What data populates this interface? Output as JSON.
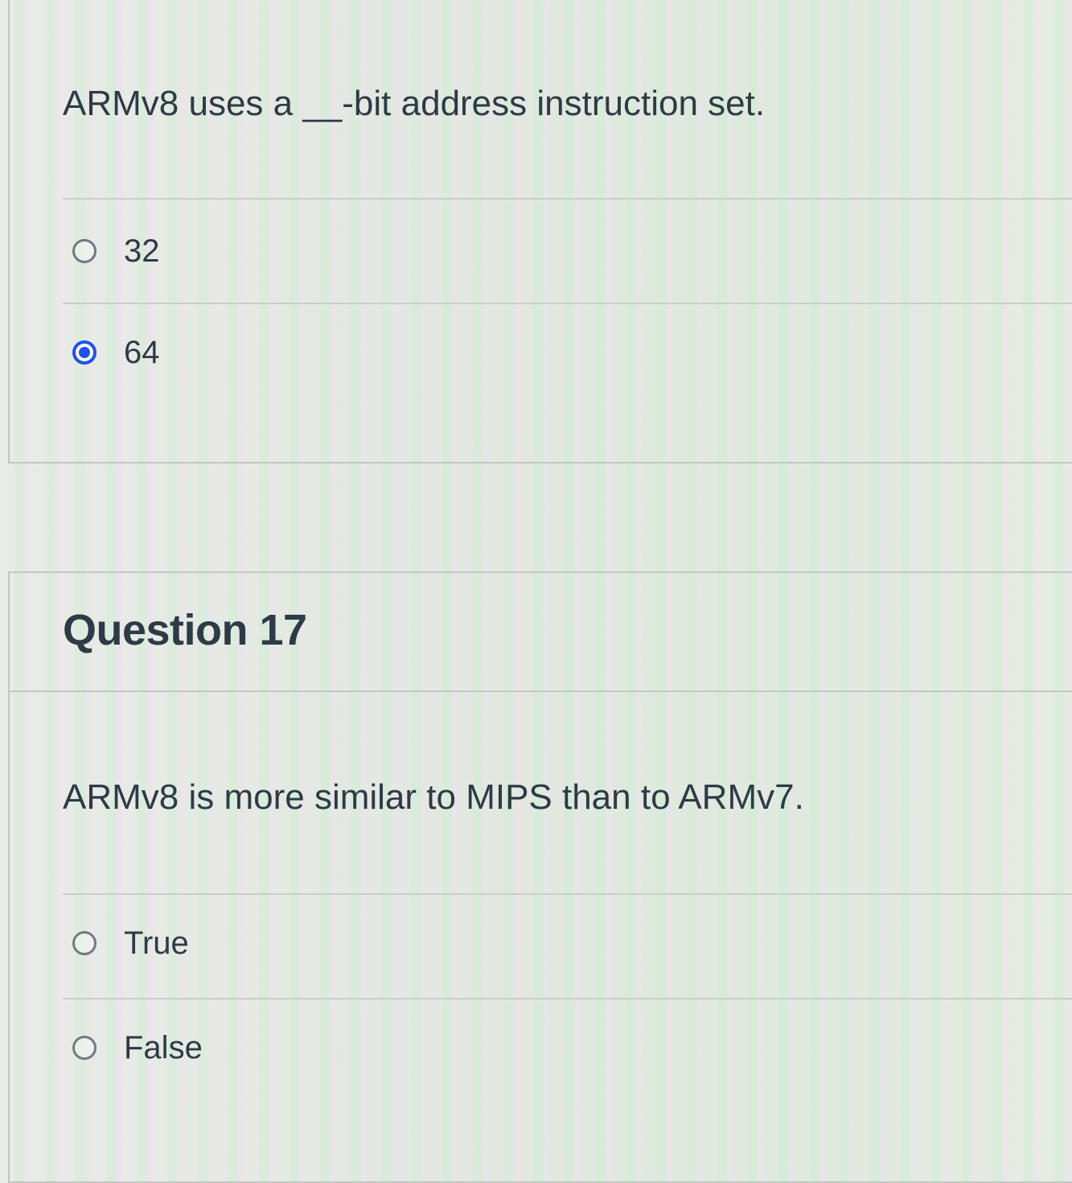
{
  "question16": {
    "text": "ARMv8 uses a __-bit address instruction set.",
    "options": [
      {
        "label": "32",
        "selected": false
      },
      {
        "label": "64",
        "selected": true
      }
    ]
  },
  "question17": {
    "header": "Question 17",
    "text": "ARMv8 is more similar to MIPS than to ARMv7.",
    "options": [
      {
        "label": "True",
        "selected": false
      },
      {
        "label": "False",
        "selected": false
      }
    ]
  },
  "colors": {
    "text": "#2d3b45",
    "radio_selected": "#1e52e8",
    "radio_border": "#6f7b82",
    "border": "#c2c7c3"
  }
}
